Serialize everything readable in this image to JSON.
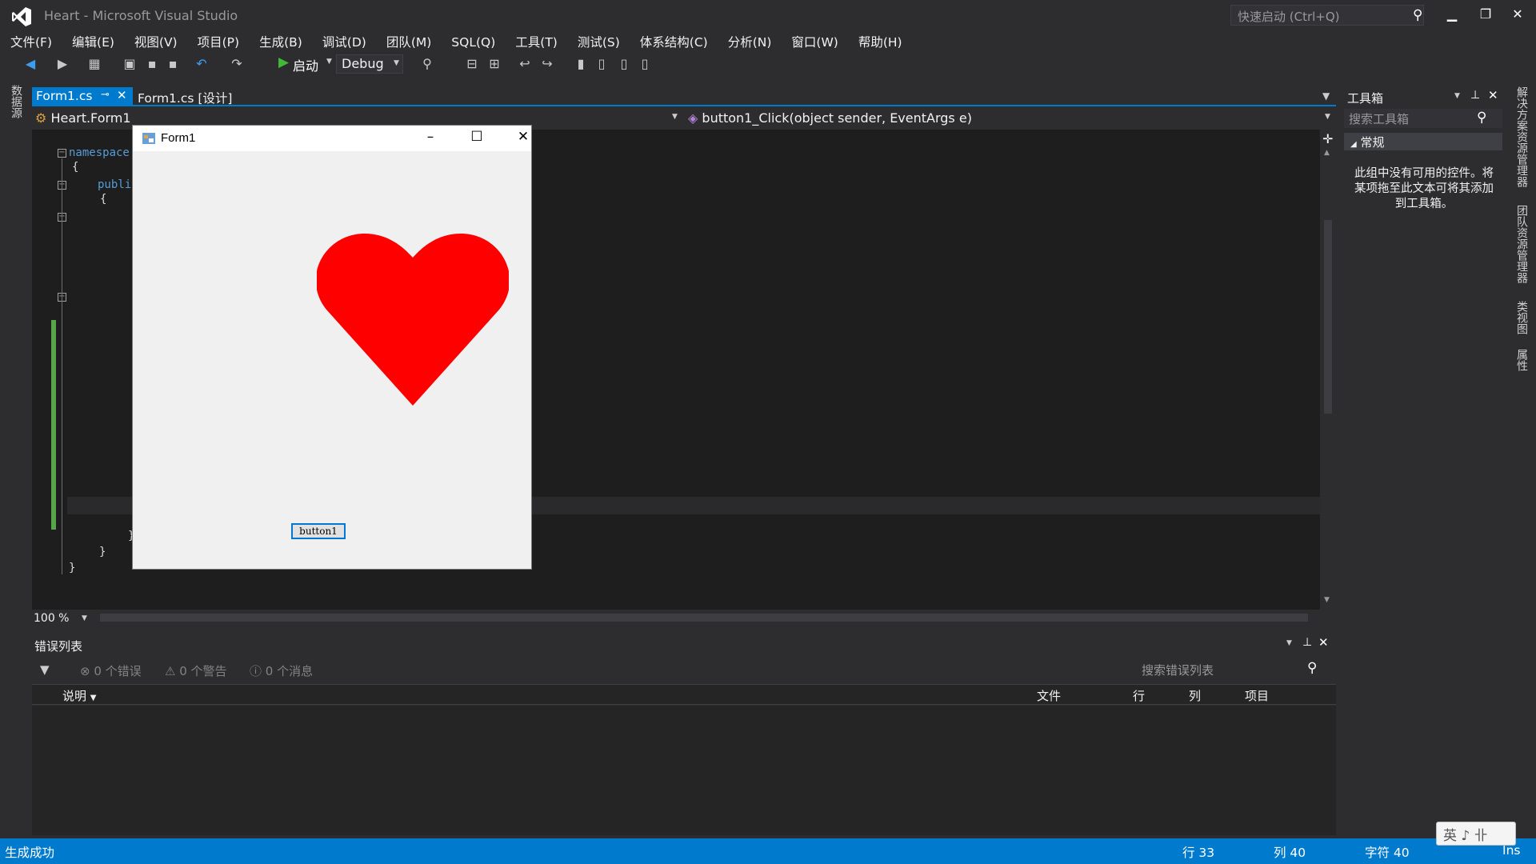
{
  "window": {
    "title": "Heart - Microsoft Visual Studio",
    "quick_launch_placeholder": "快速启动 (Ctrl+Q)"
  },
  "menu": [
    "文件(F)",
    "编辑(E)",
    "视图(V)",
    "项目(P)",
    "生成(B)",
    "调试(D)",
    "团队(M)",
    "SQL(Q)",
    "工具(T)",
    "测试(S)",
    "体系结构(C)",
    "分析(N)",
    "窗口(W)",
    "帮助(H)"
  ],
  "toolbar": {
    "start_label": "启动",
    "config": "Debug"
  },
  "left_strip": {
    "label": "数据源"
  },
  "tabs": {
    "active": "Form1.cs",
    "design": "Form1.cs [设计]"
  },
  "navbar": {
    "type": "Heart.Form1",
    "member": "button1_Click(object sender, EventArgs e)"
  },
  "code": {
    "namespace_kw": "namespace",
    "open_brace": "{",
    "public_kw": "publi",
    "close_brace": "}"
  },
  "editor": {
    "zoom": "100 %"
  },
  "form": {
    "title": "Form1",
    "button": "button1",
    "heart_color": "#ff0000"
  },
  "toolbox": {
    "title": "工具箱",
    "search_placeholder": "搜索工具箱",
    "group": "常规",
    "empty_msg": "此组中没有可用的控件。将某项拖至此文本可将其添加到工具箱。"
  },
  "right_strip": [
    "解决方案资源管理器",
    "团队资源管理器",
    "类视图",
    "属性"
  ],
  "error_list": {
    "title": "错误列表",
    "errors": "0 个错误",
    "warnings": "0 个警告",
    "messages": "0 个消息",
    "search_placeholder": "搜索错误列表",
    "columns": [
      "说明",
      "文件",
      "行",
      "列",
      "项目"
    ]
  },
  "status": {
    "message": "生成成功",
    "line": "行 33",
    "col": "列 40",
    "char": "字符 40",
    "mode": "Ins"
  },
  "ime": "英 ♪ 卝",
  "colors": {
    "accent": "#007acc",
    "bg": "#2d2d30",
    "editor_bg": "#1e1e1e"
  }
}
